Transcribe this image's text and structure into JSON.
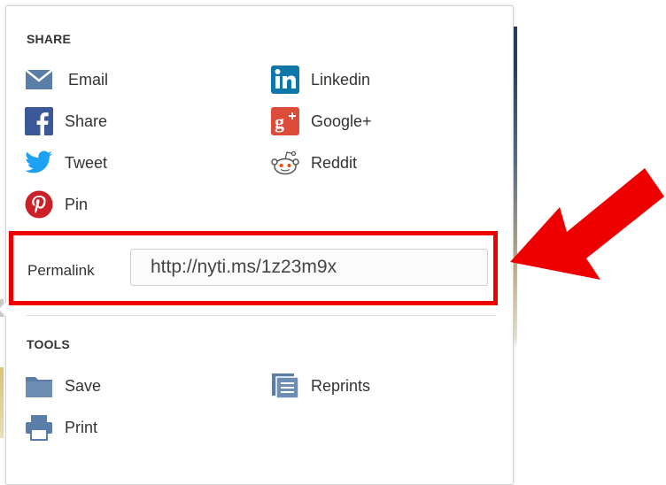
{
  "share": {
    "title": "SHARE",
    "items": [
      {
        "label": "Email",
        "icon": "envelope-icon",
        "color": "#5a7ea8"
      },
      {
        "label": "Linkedin",
        "icon": "linkedin-icon",
        "color": "#0e76a8"
      },
      {
        "label": "Share",
        "icon": "facebook-icon",
        "color": "#3b5998"
      },
      {
        "label": "Google+",
        "icon": "google-plus-icon",
        "color": "#dd4b39"
      },
      {
        "label": "Tweet",
        "icon": "twitter-icon",
        "color": "#1da1f2"
      },
      {
        "label": "Reddit",
        "icon": "reddit-icon",
        "color": "#ff4500"
      },
      {
        "label": "Pin",
        "icon": "pinterest-icon",
        "color": "#cb2027"
      }
    ]
  },
  "permalink": {
    "label": "Permalink",
    "value": "http://nyti.ms/1z23m9x"
  },
  "tools": {
    "title": "TOOLS",
    "items": [
      {
        "label": "Save",
        "icon": "folder-icon",
        "color": "#5a7ea8"
      },
      {
        "label": "Reprints",
        "icon": "reprints-icon",
        "color": "#5a7ea8"
      },
      {
        "label": "Print",
        "icon": "printer-icon",
        "color": "#5a7ea8"
      }
    ]
  },
  "annotation": {
    "highlight_color": "#ee0000"
  }
}
